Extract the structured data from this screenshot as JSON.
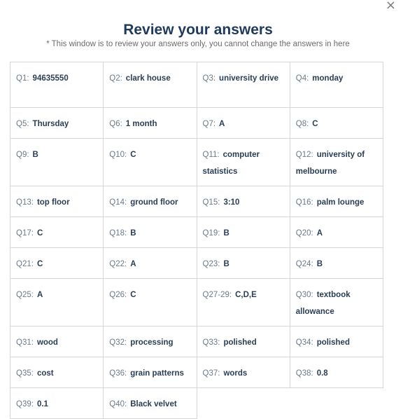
{
  "dialog": {
    "title": "Review your answers",
    "subtitle": "* This window is to review your answers only, you cannot change the answers in here"
  },
  "answers": [
    {
      "q": "Q1:",
      "a": "94635550"
    },
    {
      "q": "Q2:",
      "a": "clark house"
    },
    {
      "q": "Q3:",
      "a": "university drive"
    },
    {
      "q": "Q4:",
      "a": "monday"
    },
    {
      "q": "Q5:",
      "a": "Thursday"
    },
    {
      "q": "Q6:",
      "a": "1 month"
    },
    {
      "q": "Q7:",
      "a": "A"
    },
    {
      "q": "Q8:",
      "a": "C"
    },
    {
      "q": "Q9:",
      "a": "B"
    },
    {
      "q": "Q10:",
      "a": "C"
    },
    {
      "q": "Q11:",
      "a": "computer statistics"
    },
    {
      "q": "Q12:",
      "a": "university of melbourne"
    },
    {
      "q": "Q13:",
      "a": "top floor"
    },
    {
      "q": "Q14:",
      "a": "ground floor"
    },
    {
      "q": "Q15:",
      "a": "3:10"
    },
    {
      "q": "Q16:",
      "a": "palm lounge"
    },
    {
      "q": "Q17:",
      "a": "C"
    },
    {
      "q": "Q18:",
      "a": "B"
    },
    {
      "q": "Q19:",
      "a": "B"
    },
    {
      "q": "Q20:",
      "a": "A"
    },
    {
      "q": "Q21:",
      "a": "C"
    },
    {
      "q": "Q22:",
      "a": "A"
    },
    {
      "q": "Q23:",
      "a": "B"
    },
    {
      "q": "Q24:",
      "a": "B"
    },
    {
      "q": "Q25:",
      "a": "A"
    },
    {
      "q": "Q26:",
      "a": "C"
    },
    {
      "q": "Q27-29:",
      "a": "C,D,E"
    },
    {
      "q": "Q30:",
      "a": "textbook allowance"
    },
    {
      "q": "Q31:",
      "a": "wood"
    },
    {
      "q": "Q32:",
      "a": "processing"
    },
    {
      "q": "Q33:",
      "a": "polished"
    },
    {
      "q": "Q34:",
      "a": "polished"
    },
    {
      "q": "Q35:",
      "a": "cost"
    },
    {
      "q": "Q36:",
      "a": "grain patterns"
    },
    {
      "q": "Q37:",
      "a": "words"
    },
    {
      "q": "Q38:",
      "a": "0.8"
    },
    {
      "q": "Q39:",
      "a": "0.1"
    },
    {
      "q": "Q40:",
      "a": "Black velvet"
    }
  ],
  "icons": {
    "close": "close-icon"
  }
}
